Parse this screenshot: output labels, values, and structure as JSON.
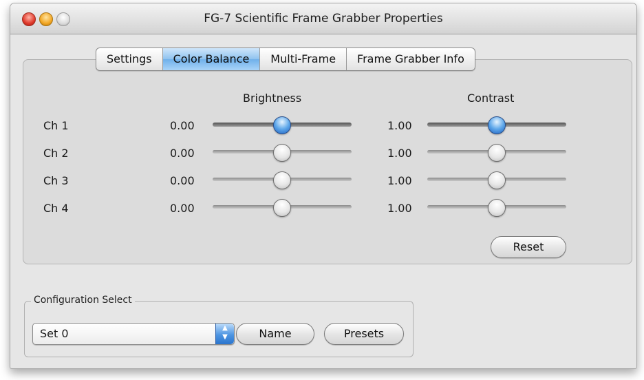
{
  "window": {
    "title": "FG-7 Scientific Frame Grabber Properties"
  },
  "tabs": [
    {
      "label": "Settings"
    },
    {
      "label": "Color Balance"
    },
    {
      "label": "Multi-Frame"
    },
    {
      "label": "Frame Grabber Info"
    }
  ],
  "selected_tab": "Color Balance",
  "columns": {
    "brightness": "Brightness",
    "contrast": "Contrast"
  },
  "channels": [
    {
      "label": "Ch 1",
      "brightness": "0.00",
      "contrast": "1.00"
    },
    {
      "label": "Ch 2",
      "brightness": "0.00",
      "contrast": "1.00"
    },
    {
      "label": "Ch 3",
      "brightness": "0.00",
      "contrast": "1.00"
    },
    {
      "label": "Ch 4",
      "brightness": "0.00",
      "contrast": "1.00"
    }
  ],
  "reset_label": "Reset",
  "config": {
    "group_title": "Configuration Select",
    "selected": "Set 0",
    "name_button": "Name",
    "presets_button": "Presets"
  },
  "colors": {
    "accent": "#5fa8ea",
    "selected_tab": "#8fc2ef"
  }
}
